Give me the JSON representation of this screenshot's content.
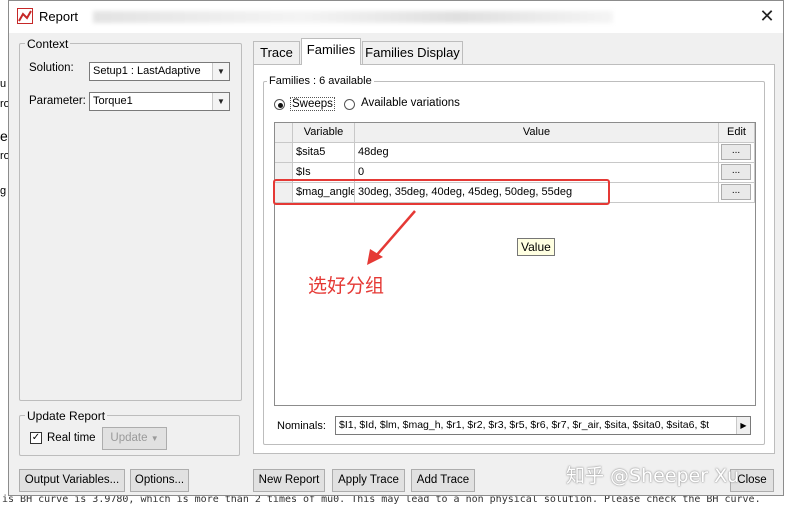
{
  "window": {
    "title": "Report",
    "close_glyph": "✕"
  },
  "context": {
    "label": "Context",
    "solution_label": "Solution:",
    "solution_value": "Setup1 : LastAdaptive",
    "parameter_label": "Parameter:",
    "parameter_value": "Torque1"
  },
  "update_report": {
    "label": "Update Report",
    "realtime_label": "Real time",
    "realtime_checked": true,
    "update_button": "Update"
  },
  "tabs": [
    {
      "label": "Trace"
    },
    {
      "label": "Families"
    },
    {
      "label": "Families Display"
    }
  ],
  "families": {
    "count_label": "Families : 6 available",
    "sweeps_label": "Sweeps",
    "variations_label": "Available variations",
    "columns": {
      "variable": "Variable",
      "value": "Value",
      "edit": "Edit"
    },
    "rows": [
      {
        "variable": "$sita5",
        "value": "48deg",
        "edit": "..."
      },
      {
        "variable": "$Is",
        "value": "0",
        "edit": "..."
      },
      {
        "variable": "$mag_angle",
        "value": "30deg, 35deg, 40deg, 45deg, 50deg, 55deg",
        "edit": "..."
      }
    ],
    "tooltip": "Value",
    "nominals_label": "Nominals:",
    "nominals_value": "$I1, $Id, $lm, $mag_h, $r1, $r2, $r3, $r5, $r6, $r7, $r_air, $sita, $sita0, $sita6, $t"
  },
  "annotation": {
    "text": "选好分组",
    "color": "#e53935"
  },
  "watermark": "知乎 @Sheeper Xu",
  "buttons": {
    "output_variables": "Output Variables...",
    "options": "Options...",
    "new_report": "New Report",
    "apply_trace": "Apply Trace",
    "add_trace": "Add Trace",
    "close": "Close"
  },
  "background": {
    "left_fragments": [
      "u",
      "ro",
      "e",
      "ro",
      "g"
    ],
    "log_line": "is BH curve is 3.9780, which is more than 2 times of mu0. This may lead to a non physical solution. Please check the BH curve."
  }
}
